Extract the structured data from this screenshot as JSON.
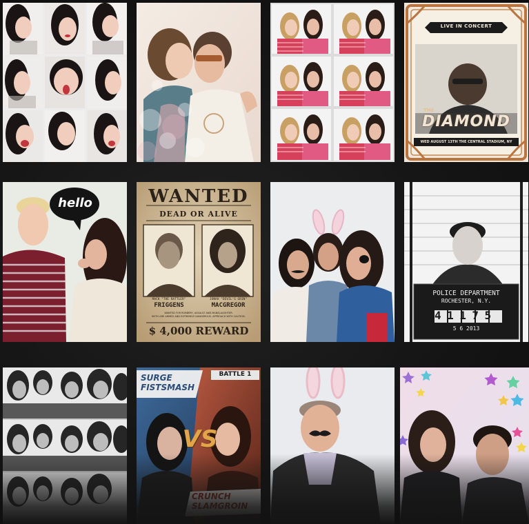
{
  "gallery": {
    "tiles": [
      {
        "name": "tile-selfie-collage",
        "alt": "photo collage of selfie expressions"
      },
      {
        "name": "tile-kiss-photo",
        "alt": "couple kissing"
      },
      {
        "name": "tile-photobooth-strip",
        "alt": "photobooth strip of two girls"
      },
      {
        "name": "tile-concert-poster",
        "alt": "concert poster"
      },
      {
        "name": "tile-hello-bubble",
        "alt": "friends with hello speech bubble"
      },
      {
        "name": "tile-wanted-poster",
        "alt": "wanted poster"
      },
      {
        "name": "tile-bunny-ears",
        "alt": "friends with bunny ears and mustache"
      },
      {
        "name": "tile-mugshot",
        "alt": "police mugshot"
      },
      {
        "name": "tile-bw-collage",
        "alt": "black and white photo collage"
      },
      {
        "name": "tile-battle-poster",
        "alt": "battle versus poster"
      },
      {
        "name": "tile-bunny-man",
        "alt": "man with bunny ears and mustache"
      },
      {
        "name": "tile-stars-frame",
        "alt": "couple with star frame"
      }
    ]
  },
  "concert": {
    "banner": "LIVE IN CONCERT",
    "title": "DIAMOND",
    "prefix": "THE",
    "footer": "WED AUGUST 13TH  THE CENTRAL STADIUM, NY"
  },
  "hello": {
    "bubble": "hello"
  },
  "wanted": {
    "title": "WANTED",
    "subtitle": "DEAD OR ALIVE",
    "left_alias": "MACK \"THE RATTLER\"",
    "left_name": "FRIGGENS",
    "right_alias": "JONAH \"DEVIL'S GRIN\"",
    "right_name": "MACGREGOR",
    "fine_print_1": "WANTED FOR ROBBERY, ASSAULT AND MANSLAUGHTER.",
    "fine_print_2": "BOTH ARE ARMED AND EXTREMELY DANGEROUS. APPROACH WITH CAUTION.",
    "reward": "$ 4,000 REWARD"
  },
  "mugshot": {
    "dept": "POLICE DEPARTMENT",
    "city": "ROCHESTER, N.Y.",
    "number": "41175",
    "date": "5 6 2013"
  },
  "battle": {
    "tag": "BATTLE 1",
    "left_name_1": "SURGE",
    "left_name_2": "FISTSMASH",
    "vs": "VS",
    "right_name_1": "CRUNCH",
    "right_name_2": "SLAMGROIN"
  }
}
